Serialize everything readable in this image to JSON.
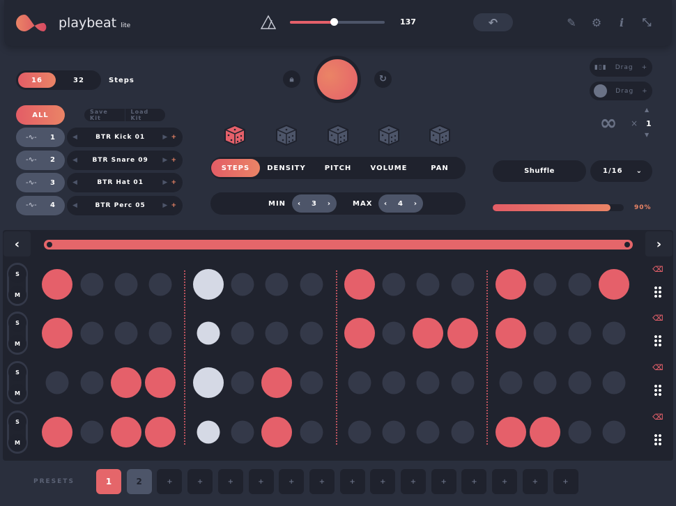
{
  "header": {
    "logo": "playbeat",
    "logo_sub": "lite",
    "tempo": 137,
    "tempo_fraction": 0.46,
    "icons": [
      "metronome-icon",
      "undo-icon",
      "pencil-icon",
      "gear-icon",
      "info-icon",
      "collapse-icon"
    ]
  },
  "steps": {
    "options": [
      "16",
      "32"
    ],
    "selected": "16",
    "label": "Steps"
  },
  "kit": {
    "all_label": "ALL",
    "save": "Save Kit",
    "load": "Load Kit",
    "tracks": [
      {
        "num": "1",
        "name": "BTR Kick 01"
      },
      {
        "num": "2",
        "name": "BTR Snare 09"
      },
      {
        "num": "3",
        "name": "BTR Hat 01"
      },
      {
        "num": "4",
        "name": "BTR Perc 05"
      }
    ]
  },
  "modes": {
    "tabs": [
      "STEPS",
      "DENSITY",
      "PITCH",
      "VOLUME",
      "PAN"
    ],
    "active": "STEPS"
  },
  "range": {
    "min_label": "MIN",
    "min": "3",
    "max_label": "MAX",
    "max": "4"
  },
  "export": {
    "audio_drag": "Drag",
    "midi_drag": "Drag",
    "plus": "+",
    "loop_x": "×",
    "loop_count": "1"
  },
  "shuffle": {
    "label": "Shuffle",
    "division": "1/16",
    "amount_label": "90%",
    "amount": 0.9
  },
  "grid": {
    "playhead_step": 5,
    "rows": [
      "1000100010001001",
      "1000000010111000",
      "0011101000000000",
      "1011001000001100"
    ],
    "solo": "S",
    "mute": "M"
  },
  "presets": {
    "label": "PRESETS",
    "slots": [
      "1",
      "2",
      "+",
      "+",
      "+",
      "+",
      "+",
      "+",
      "+",
      "+",
      "+",
      "+",
      "+",
      "+",
      "+",
      "+",
      "+"
    ],
    "active": "1"
  },
  "colors": {
    "accent": "#e5606a",
    "accent2": "#ea8466",
    "bg": "#2a2f3d",
    "panel": "#1f222d"
  }
}
